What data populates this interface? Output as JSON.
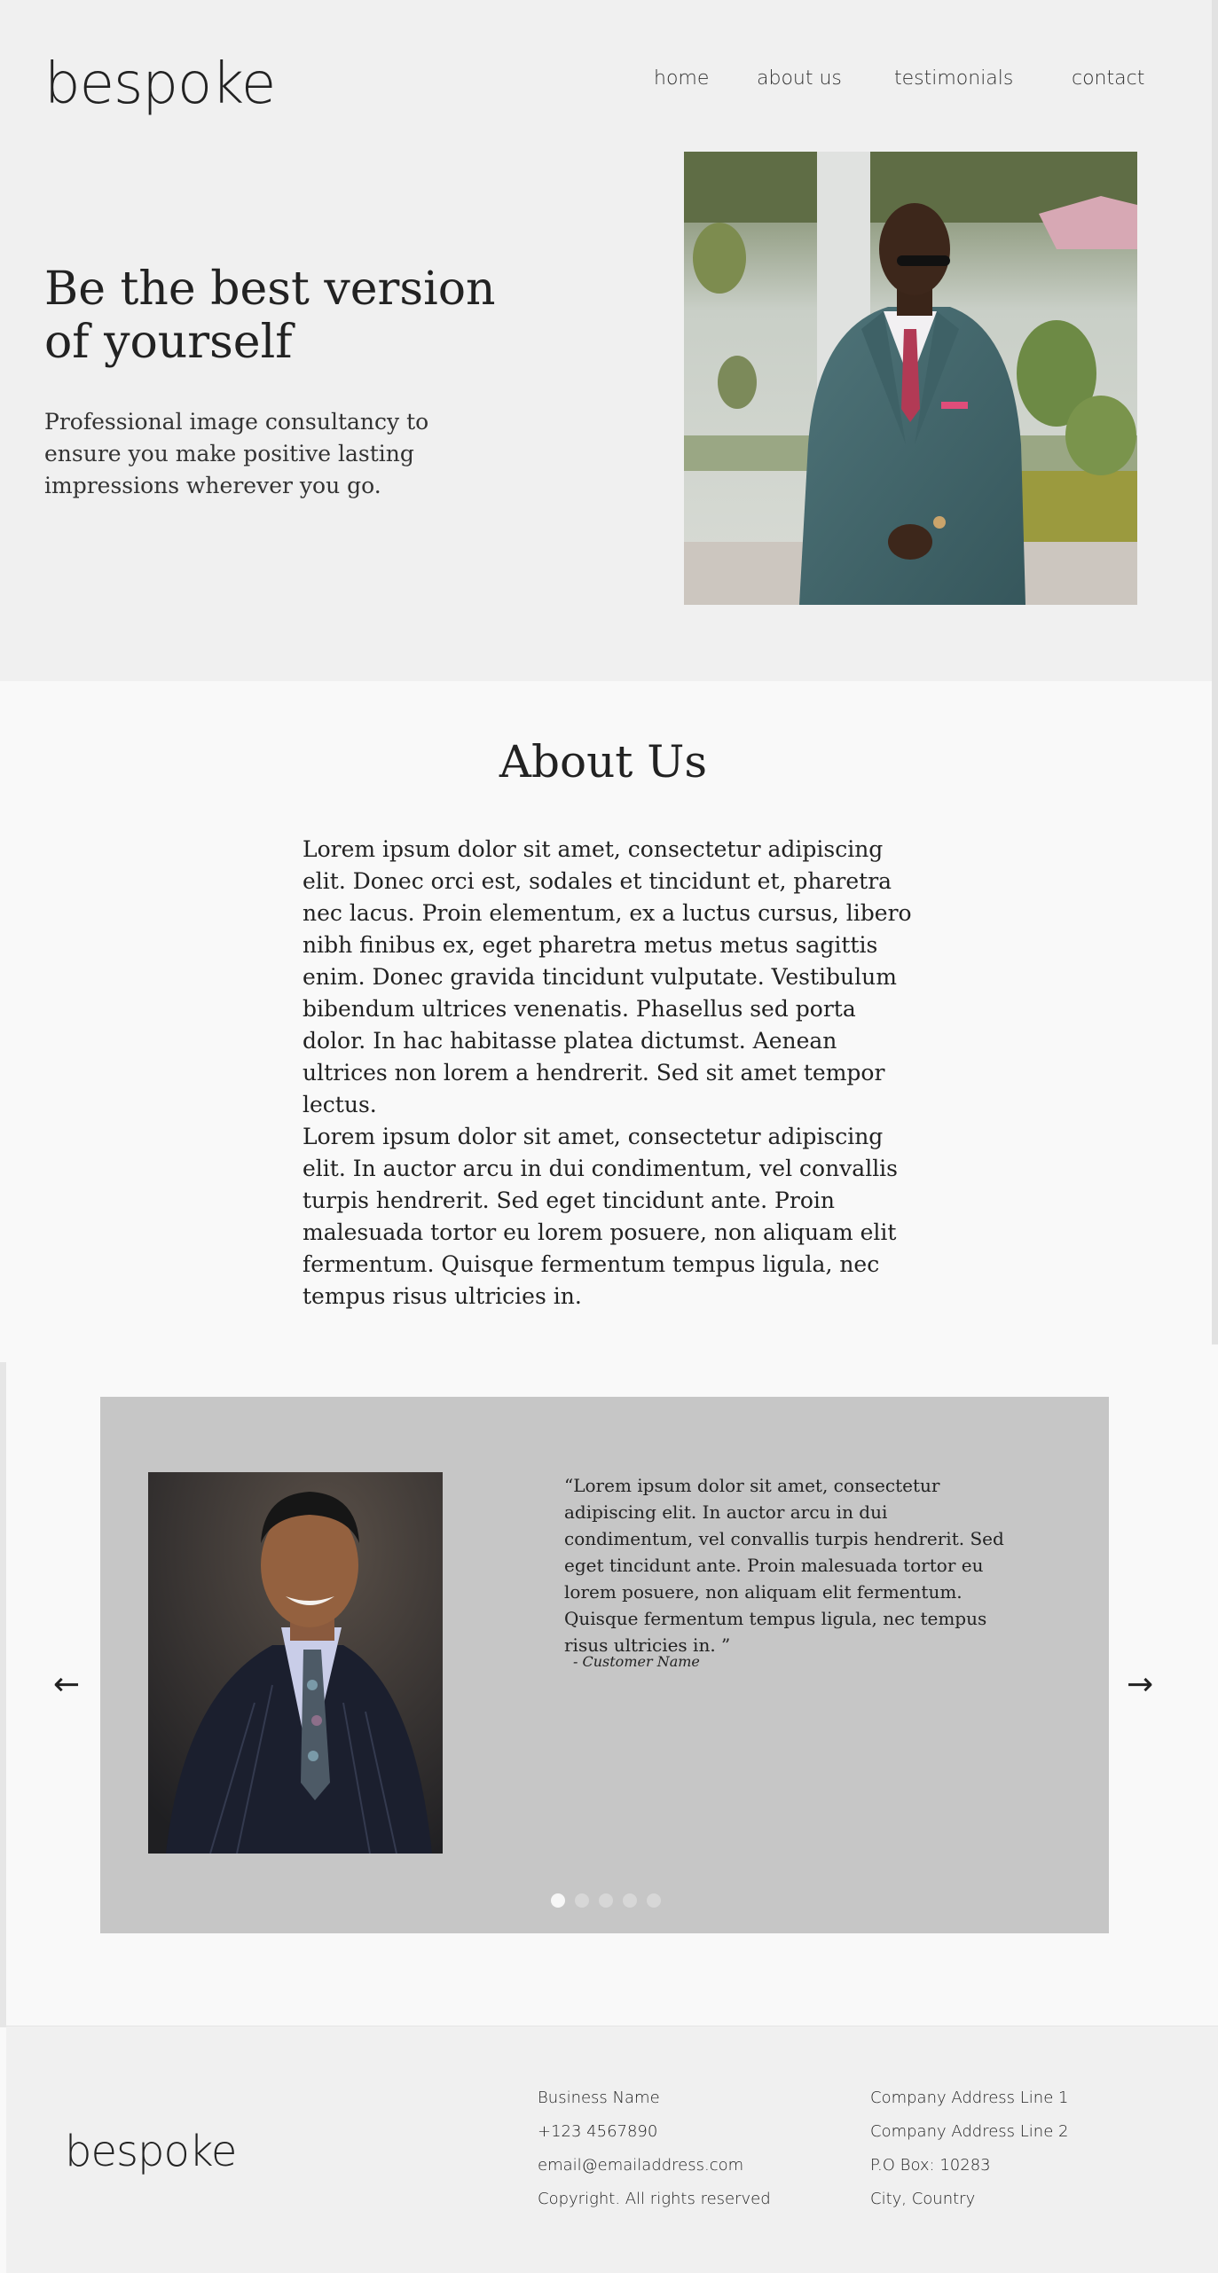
{
  "brand": {
    "logo": "bespoke"
  },
  "nav": {
    "items": [
      {
        "label": "home"
      },
      {
        "label": "about us"
      },
      {
        "label": "testimonials"
      },
      {
        "label": "contact"
      }
    ]
  },
  "hero": {
    "title": "Be the best version of yourself",
    "subtitle": "Professional image consultancy to ensure you make positive lasting impressions wherever you go.",
    "image": "man-in-teal-double-breasted-suit-photo"
  },
  "about": {
    "title": "About Us",
    "paragraphs": [
      "Lorem ipsum dolor sit amet, consectetur adipiscing elit. Donec orci est, sodales et tincidunt et, pharetra nec lacus. Proin elementum, ex a luctus cursus, libero nibh finibus ex, eget pharetra metus metus sagittis enim. Donec gravida tincidunt vulputate. Vestibulum bibendum ultrices venenatis. Phasellus sed porta dolor. In hac habitasse platea dictumst. Aenean ultrices non lorem a hendrerit. Sed sit amet tempor lectus.",
      "Lorem ipsum dolor sit amet, consectetur adipiscing elit. In auctor arcu in dui condimentum, vel convallis turpis hendrerit. Sed eget tincidunt ante. Proin malesuada tortor eu lorem posuere, non aliquam elit fermentum. Quisque fermentum tempus ligula, nec tempus risus ultricies in."
    ]
  },
  "testimonial": {
    "quote": "“Lorem ipsum dolor sit amet, consectetur adipiscing elit. In auctor arcu in dui condimentum, vel convallis turpis hendrerit. Sed eget tincidunt ante. Proin malesuada tortor eu lorem posuere, non aliquam elit fermentum. Quisque fermentum tempus ligula, nec tempus risus ultricies in. ”",
    "author": "-  Customer Name",
    "image": "smiling-man-in-pinstripe-suit-photo",
    "prev_icon": "←",
    "next_icon": "→",
    "slide_count": 5,
    "active_slide": 1
  },
  "footer": {
    "logo": "bespoke",
    "contact": [
      "Business Name",
      "+123 4567890",
      "email@emailaddress.com",
      "Copyright. All rights reserved"
    ],
    "address": [
      "Company Address Line 1",
      "Company Address Line 2",
      "P.O Box: 10283",
      "City, Country"
    ]
  },
  "colors": {
    "hero_bg": "#f0f0f0",
    "page_bg": "#f9f9f9",
    "testimonial_bg": "#c6c6c6",
    "text": "#222222"
  }
}
